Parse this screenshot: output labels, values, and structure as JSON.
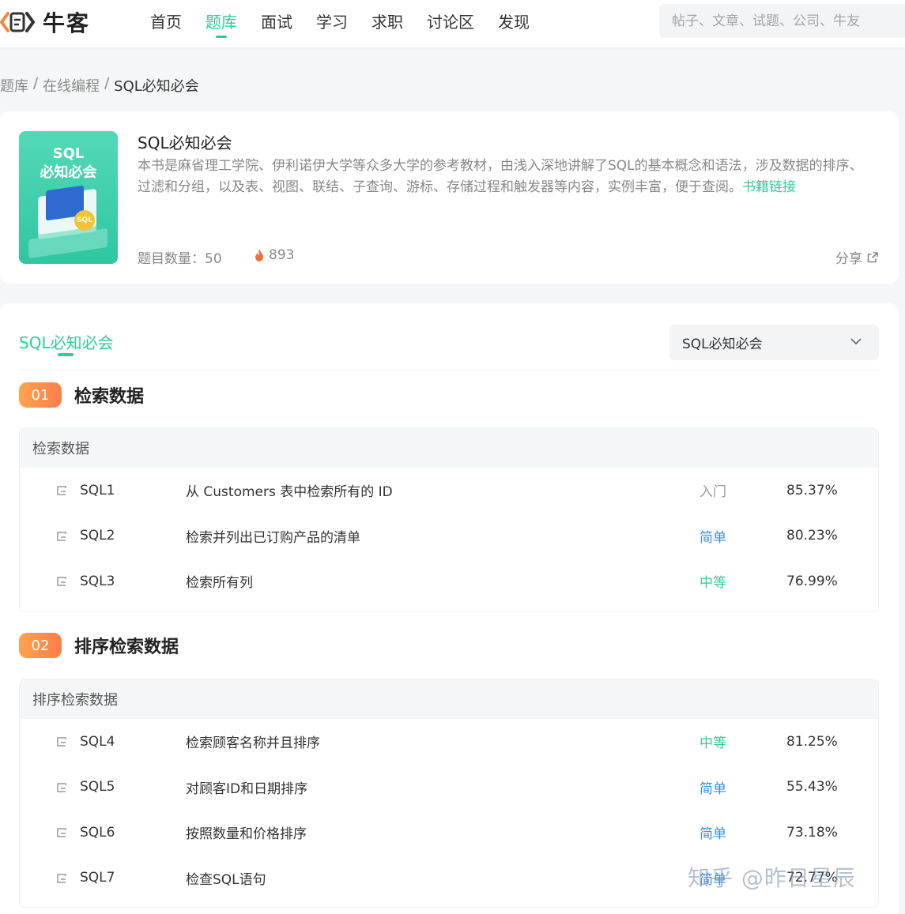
{
  "header": {
    "logo_text": "牛客",
    "nav": [
      {
        "label": "首页",
        "active": false
      },
      {
        "label": "题库",
        "active": true
      },
      {
        "label": "面试",
        "active": false
      },
      {
        "label": "学习",
        "active": false
      },
      {
        "label": "求职",
        "active": false
      },
      {
        "label": "讨论区",
        "active": false
      },
      {
        "label": "发现",
        "active": false
      }
    ],
    "search_placeholder": "帖子、文章、试题、公司、牛友"
  },
  "breadcrumb": {
    "item1": "题库",
    "item2": "在线编程",
    "current": "SQL必知必会",
    "sep": "/"
  },
  "book": {
    "cover_line1": "SQL",
    "cover_line2": "必知必会",
    "cover_badge": "SQL",
    "title": "SQL必知必会",
    "description": "本书是麻省理工学院、伊利诺伊大学等众多大学的参考教材，由浅入深地讲解了SQL的基本概念和语法，涉及数据的排序、过滤和分组，以及表、视图、联结、子查询、游标、存储过程和触发器等内容，实例丰富，便于查阅。",
    "link_label": "书籍链接",
    "count_label": "题目数量：50",
    "hot_count": "893",
    "share_label": "分享"
  },
  "panel": {
    "tab_label": "SQL必知必会",
    "select_value": "SQL必知必会"
  },
  "chapters": [
    {
      "num": "01",
      "title": "检索数据",
      "section": "检索数据",
      "rows": [
        {
          "id": "SQL1",
          "title": "从 Customers 表中检索所有的 ID",
          "level": "入门",
          "rate": "85.37%"
        },
        {
          "id": "SQL2",
          "title": "检索并列出已订购产品的清单",
          "level": "简单",
          "rate": "80.23%"
        },
        {
          "id": "SQL3",
          "title": "检索所有列",
          "level": "中等",
          "rate": "76.99%"
        }
      ]
    },
    {
      "num": "02",
      "title": "排序检索数据",
      "section": "排序检索数据",
      "rows": [
        {
          "id": "SQL4",
          "title": "检索顾客名称并且排序",
          "level": "中等",
          "rate": "81.25%"
        },
        {
          "id": "SQL5",
          "title": "对顾客ID和日期排序",
          "level": "简单",
          "rate": "55.43%"
        },
        {
          "id": "SQL6",
          "title": "按照数量和价格排序",
          "level": "简单",
          "rate": "73.18%"
        },
        {
          "id": "SQL7",
          "title": "检查SQL语句",
          "level": "简单",
          "rate": "72.77%"
        }
      ]
    }
  ],
  "level_colors": {
    "入门": "#999999",
    "简单": "#3d8fd9",
    "中等": "#32ca99"
  },
  "colors": {
    "accent": "#32ca99",
    "chapter_badge": "#ff8d4d"
  },
  "watermark": "知乎 @昨日星辰"
}
